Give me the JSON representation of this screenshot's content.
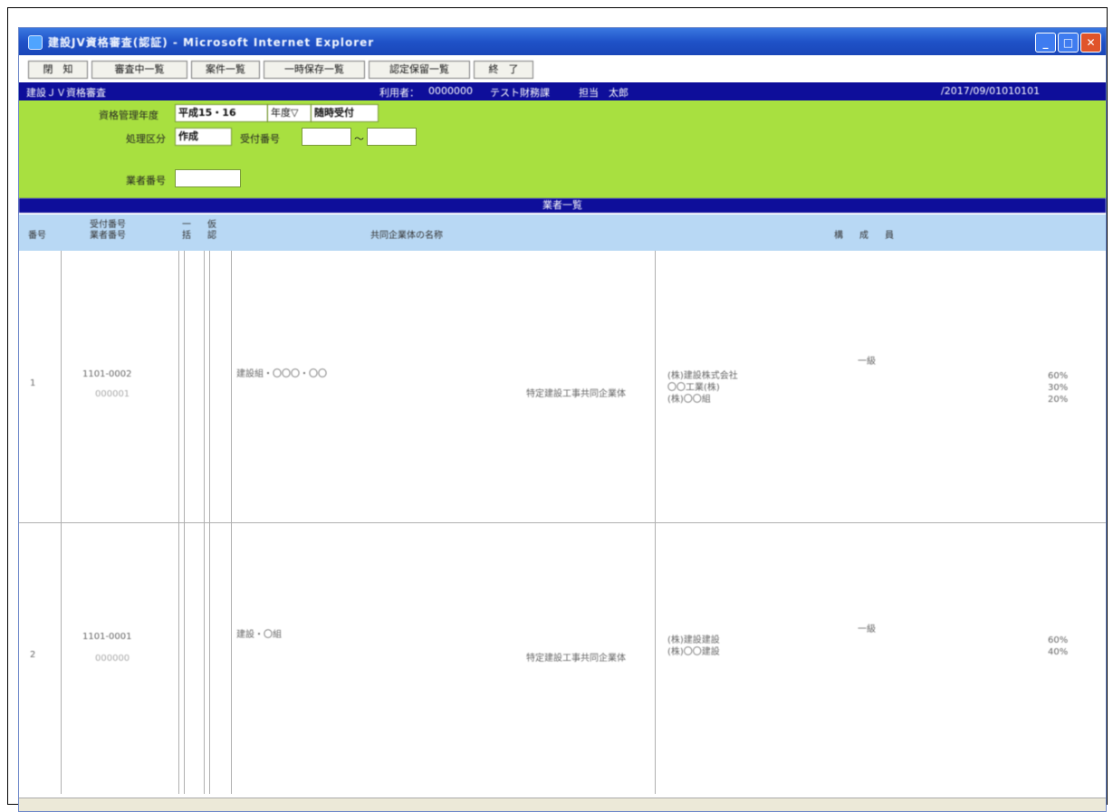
{
  "window": {
    "title": "建設JV資格審査(認証) - Microsoft Internet Explorer"
  },
  "toolbar": {
    "buttons": [
      "閉　知",
      "審査中一覧",
      "案件一覧",
      "一時保存一覧",
      "認定保留一覧",
      "終　了"
    ]
  },
  "navbar": {
    "app_name": "建設ＪＶ資格審査",
    "user_label": "利用者：",
    "user_id": "0000000",
    "dept": "テスト財務課",
    "user_name": "担当　太郎",
    "datetime": "/2017/09/01010101"
  },
  "filter": {
    "year_label": "資格管理年度",
    "year_value": "平成15・16",
    "year_mode": "年度▽",
    "reception_type": "随時受付",
    "process_label": "処理区分",
    "process_value": "作成",
    "receipt_label": "受付番号",
    "receipt_sep": "～",
    "case_label": "業者番号",
    "receipt_from": "",
    "receipt_to": "",
    "case_value": ""
  },
  "section_title": "業者一覧",
  "table": {
    "headers": {
      "no": "番号",
      "receipt": "受付番号\n業者番号",
      "c1": "一\n括",
      "c2": "仮\n認",
      "name": "共同企業体の名称",
      "members": "構　成　員"
    },
    "rows": [
      {
        "no": "1",
        "receipt_no": "1101-0002",
        "case_no": "000001",
        "name": "建設組・〇〇〇・〇〇",
        "type": "特定建設工事共同企業体",
        "members": [
          "(株)建設株式会社",
          "〇〇工業(株)",
          "(株)〇〇組"
        ],
        "grade": "一級",
        "ratios": [
          "60%",
          "30%",
          "20%"
        ]
      },
      {
        "no": "2",
        "receipt_no": "1101-0001",
        "case_no": "000000",
        "name": "建設・〇組",
        "type": "特定建設工事共同企業体",
        "members": [
          "(株)建設建設",
          "(株)〇〇建設"
        ],
        "grade": "一級",
        "ratios": [
          "60%",
          "40%"
        ]
      }
    ]
  }
}
